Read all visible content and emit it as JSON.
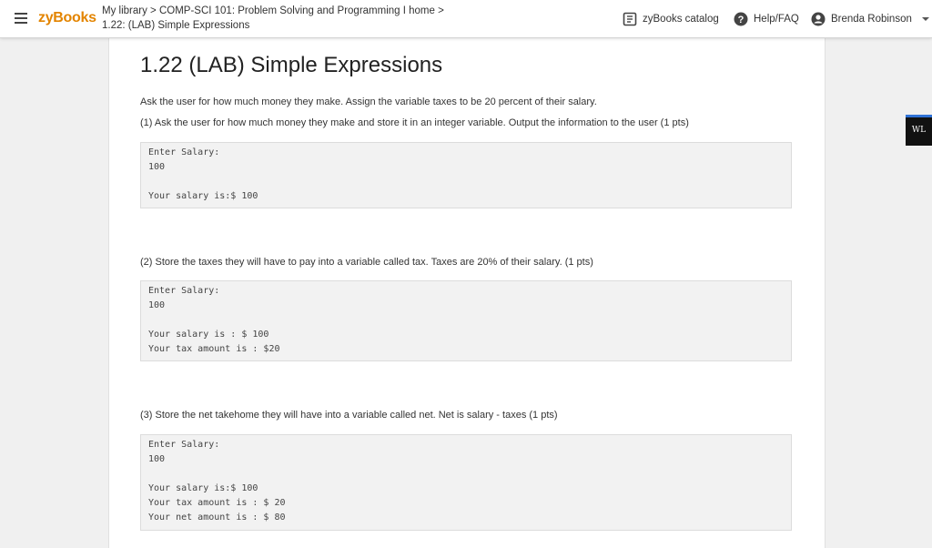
{
  "header": {
    "logo": "zyBooks",
    "breadcrumb_line1": "My library > COMP-SCI 101: Problem Solving and Programming I home >",
    "breadcrumb_line2": "1.22: (LAB) Simple Expressions",
    "catalog_label": "zyBooks catalog",
    "help_label": "Help/FAQ",
    "user_name": "Brenda Robinson"
  },
  "main": {
    "title": "1.22 (LAB) Simple Expressions",
    "intro": "Ask the user for how much money they make. Assign the variable taxes to be 20 percent of their salary.",
    "parts": [
      {
        "instruction": "(1) Ask the user for how much money they make and store it in an integer variable. Output the information to the user (1 pts)",
        "code": [
          "Enter Salary:",
          "100",
          "",
          "Your salary is:$ 100"
        ]
      },
      {
        "instruction": "(2) Store the taxes they will have to pay into a variable called tax. Taxes are 20% of their salary. (1 pts)",
        "code": [
          "Enter Salary:",
          "100",
          "",
          "Your salary is : $ 100",
          "Your tax amount is : $20"
        ]
      },
      {
        "instruction": "(3) Store the net takehome they will have into a variable called net. Net is salary - taxes (1 pts)",
        "code": [
          "Enter Salary:",
          "100",
          "",
          "Your salary is:$ 100",
          "Your tax amount is : $ 20",
          "Your net amount is : $ 80"
        ]
      }
    ]
  },
  "side_badge": {
    "label": "WL"
  },
  "colors": {
    "brand": "#e38400",
    "badge_accent": "#2f72d6"
  }
}
